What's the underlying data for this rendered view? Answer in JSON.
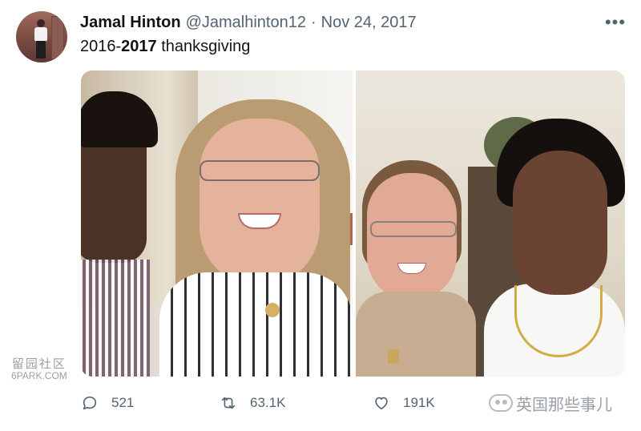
{
  "tweet": {
    "author_name": "Jamal Hinton",
    "author_handle": "@Jamalhinton12",
    "separator": "·",
    "date": "Nov 24, 2017",
    "more_label": "•••",
    "text_prefix": "2016-",
    "text_bold": "2017",
    "text_suffix": " thanksgiving"
  },
  "actions": {
    "replies": "521",
    "retweets": "63.1K",
    "likes": "191K"
  },
  "watermarks": {
    "left_cjk": "留园社区",
    "left_latin": "6PARK.COM",
    "right_text": "英国那些事儿"
  },
  "colors": {
    "text_primary": "#0f1419",
    "text_secondary": "#536471",
    "background": "#ffffff"
  },
  "icons": {
    "more": "more-horizontal-icon",
    "reply": "reply-bubble-icon",
    "retweet": "retweet-arrows-icon",
    "like": "heart-icon"
  }
}
